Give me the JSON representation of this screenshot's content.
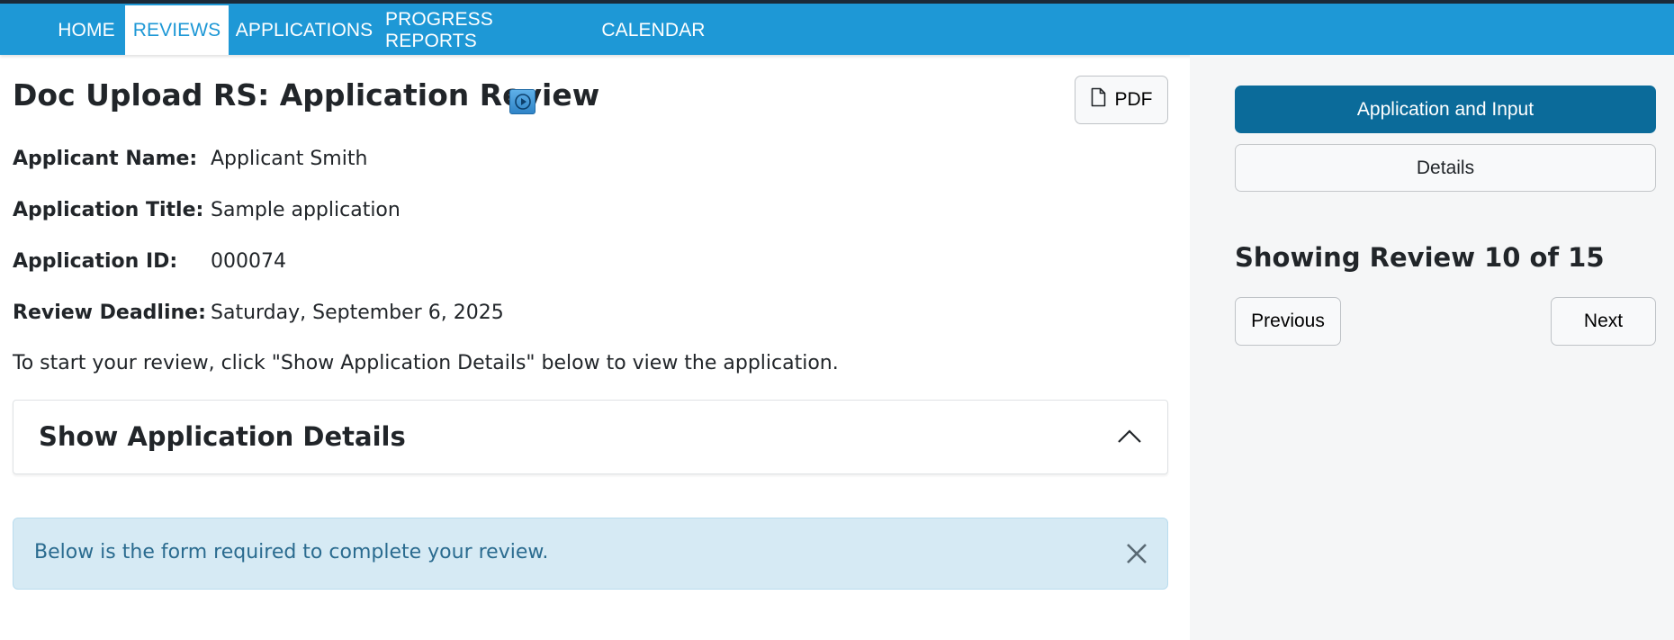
{
  "nav": {
    "items": [
      {
        "label": "HOME"
      },
      {
        "label": "REVIEWS"
      },
      {
        "label": "APPLICATIONS"
      },
      {
        "label": "PROGRESS REPORTS"
      },
      {
        "label": "CALENDAR"
      }
    ],
    "active": "REVIEWS"
  },
  "header": {
    "title": "Doc Upload RS: Application Review",
    "pdf_label": "PDF",
    "play_icon": "play-icon",
    "pdf_icon": "document-icon"
  },
  "fields": [
    {
      "label": "Applicant Name:",
      "value": "Applicant Smith"
    },
    {
      "label": "Application Title:",
      "value": "Sample application"
    },
    {
      "label": "Application ID:",
      "value": "000074"
    },
    {
      "label": "Review Deadline:",
      "value": "Saturday, September 6, 2025"
    }
  ],
  "instructions": "To start your review, click \"Show Application Details\" below to view the application.",
  "accordion": {
    "title": "Show Application Details",
    "icon": "chevron-up-icon"
  },
  "alert": {
    "text": "Below is the form required to complete your review.",
    "icon": "close-icon"
  },
  "sidebar": {
    "primary_button": "Application and Input",
    "secondary_button": "Details",
    "showing": "Showing Review 10 of 15",
    "previous": "Previous",
    "next": "Next"
  },
  "colors": {
    "nav_bg": "#1e98d6",
    "primary": "#0b6b9a",
    "alert_bg": "#d6eaf4",
    "alert_text": "#2a6b8f"
  }
}
